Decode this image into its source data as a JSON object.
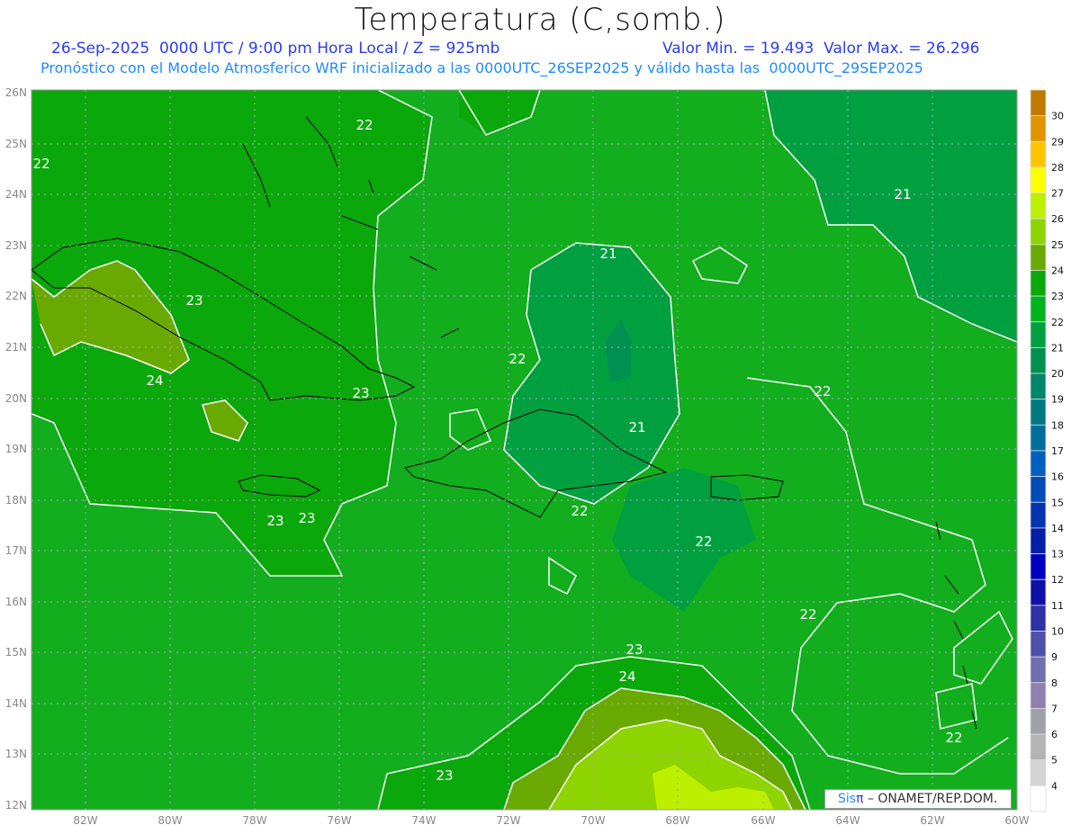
{
  "header": {
    "title": "Temperatura (C,somb.)",
    "date_line": "26-Sep-2025  0000 UTC / 9:00 pm Hora Local / Z = 925mb",
    "minmax": "Valor Min. = 19.493  Valor Max. = 26.296",
    "model_line": "Pronóstico con el Modelo Atmosferico WRF inicializado a las 0000UTC_26SEP2025 y válido hasta las  0000UTC_29SEP2025"
  },
  "map": {
    "lon_labels": [
      "82W",
      "80W",
      "78W",
      "76W",
      "74W",
      "72W",
      "70W",
      "68W",
      "66W",
      "64W",
      "62W",
      "60W"
    ],
    "lat_labels": [
      "26N",
      "25N",
      "24N",
      "23N",
      "22N",
      "21N",
      "20N",
      "19N",
      "18N",
      "17N",
      "16N",
      "15N",
      "14N",
      "13N",
      "12N"
    ],
    "contour_labels": [
      "22",
      "22",
      "21",
      "21",
      "23",
      "24",
      "22",
      "23",
      "22",
      "21",
      "23",
      "23",
      "22",
      "22",
      "22",
      "23",
      "24",
      "22",
      "23"
    ]
  },
  "colorbar": {
    "labels": [
      "30",
      "29",
      "28",
      "27",
      "26",
      "25",
      "24",
      "23",
      "22",
      "21",
      "20",
      "19",
      "18",
      "17",
      "16",
      "15",
      "14",
      "13",
      "12",
      "11",
      "10",
      "9",
      "8",
      "7",
      "6",
      "5",
      "4"
    ],
    "colors": [
      "#c07a00",
      "#e09400",
      "#ffc400",
      "#ffff00",
      "#bcf000",
      "#8ed400",
      "#6aaa00",
      "#0aa80a",
      "#00b41e",
      "#00a040",
      "#009050",
      "#00866a",
      "#007a80",
      "#006e9c",
      "#0060c0",
      "#004cb8",
      "#0034b0",
      "#0020a8",
      "#0000c0",
      "#1010a8",
      "#3030a8",
      "#5050a8",
      "#7070b0",
      "#9080b0",
      "#a0a0a8",
      "#b4b4b4",
      "#d4d4d4",
      "#ffffff"
    ]
  },
  "watermark": {
    "brand_a": "Sis",
    "brand_b": "π",
    "text": " –  ONAMET/REP.DOM."
  }
}
